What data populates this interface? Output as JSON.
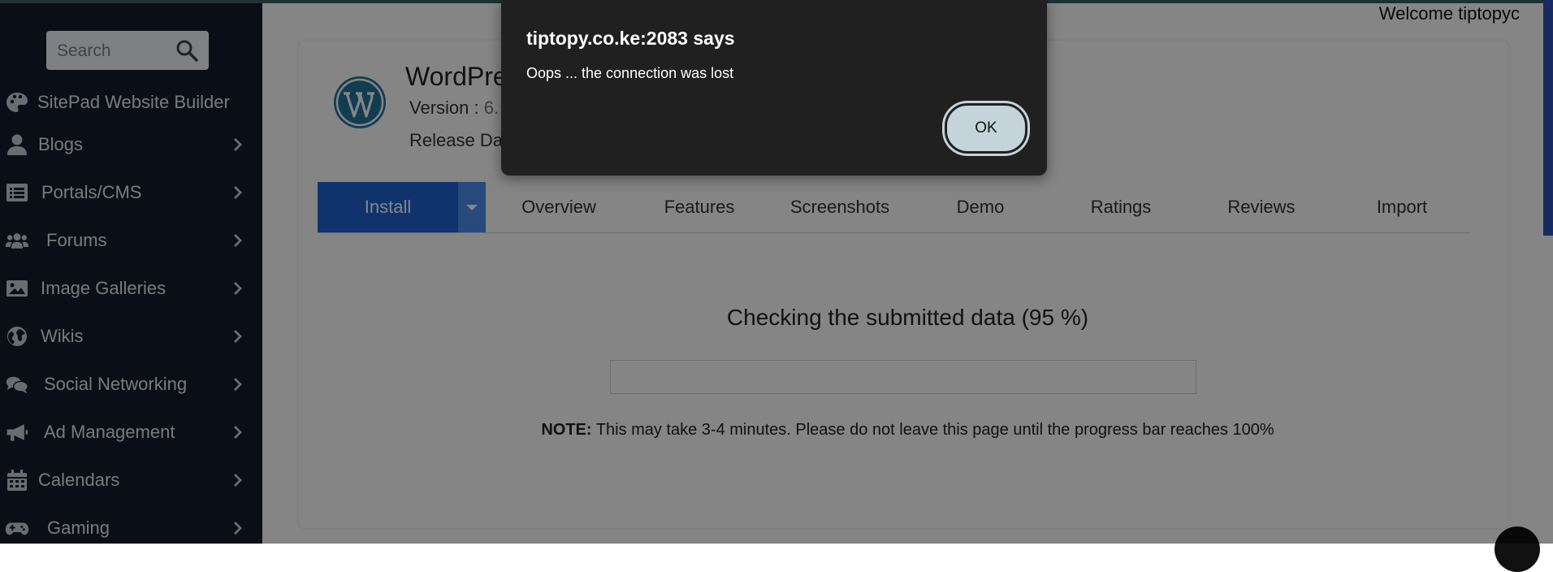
{
  "welcome": "Welcome tiptopyc",
  "search": {
    "placeholder": "Search",
    "icon": "search-icon"
  },
  "sidebar": {
    "items": [
      {
        "label": "SitePad Website Builder",
        "icon": "palette-icon",
        "has_chevron": false
      },
      {
        "label": "Blogs",
        "icon": "user-icon",
        "has_chevron": true
      },
      {
        "label": "Portals/CMS",
        "icon": "list-icon",
        "has_chevron": true
      },
      {
        "label": "Forums",
        "icon": "users-icon",
        "has_chevron": true
      },
      {
        "label": "Image Galleries",
        "icon": "image-icon",
        "has_chevron": true
      },
      {
        "label": "Wikis",
        "icon": "globe-icon",
        "has_chevron": true
      },
      {
        "label": "Social Networking",
        "icon": "comments-icon",
        "has_chevron": true
      },
      {
        "label": "Ad Management",
        "icon": "megaphone-icon",
        "has_chevron": true
      },
      {
        "label": "Calendars",
        "icon": "calendar-icon",
        "has_chevron": true
      },
      {
        "label": "Gaming",
        "icon": "gamepad-icon",
        "has_chevron": true
      }
    ]
  },
  "app": {
    "title": "WordPre",
    "version_label": "Version : ",
    "version_value": "6.",
    "release_label": "Release Da"
  },
  "tabs": {
    "install": "Install",
    "items": [
      "Overview",
      "Features",
      "Screenshots",
      "Demo",
      "Ratings",
      "Reviews",
      "Import"
    ]
  },
  "progress": {
    "heading": "Checking the submitted data (95 %)",
    "percent": 95,
    "note_label": "NOTE:",
    "note_text": " This may take 3-4 minutes. Please do not leave this page until the progress bar reaches 100%"
  },
  "dialog": {
    "title": "tiptopy.co.ke:2083 says",
    "message": "Oops ... the connection was lost",
    "ok_label": "OK"
  },
  "colors": {
    "sidebar_bg": "#141e2c",
    "install_tab": "#1f62d3",
    "dialog_bg": "#202020",
    "ok_button": "#c5d3db"
  }
}
